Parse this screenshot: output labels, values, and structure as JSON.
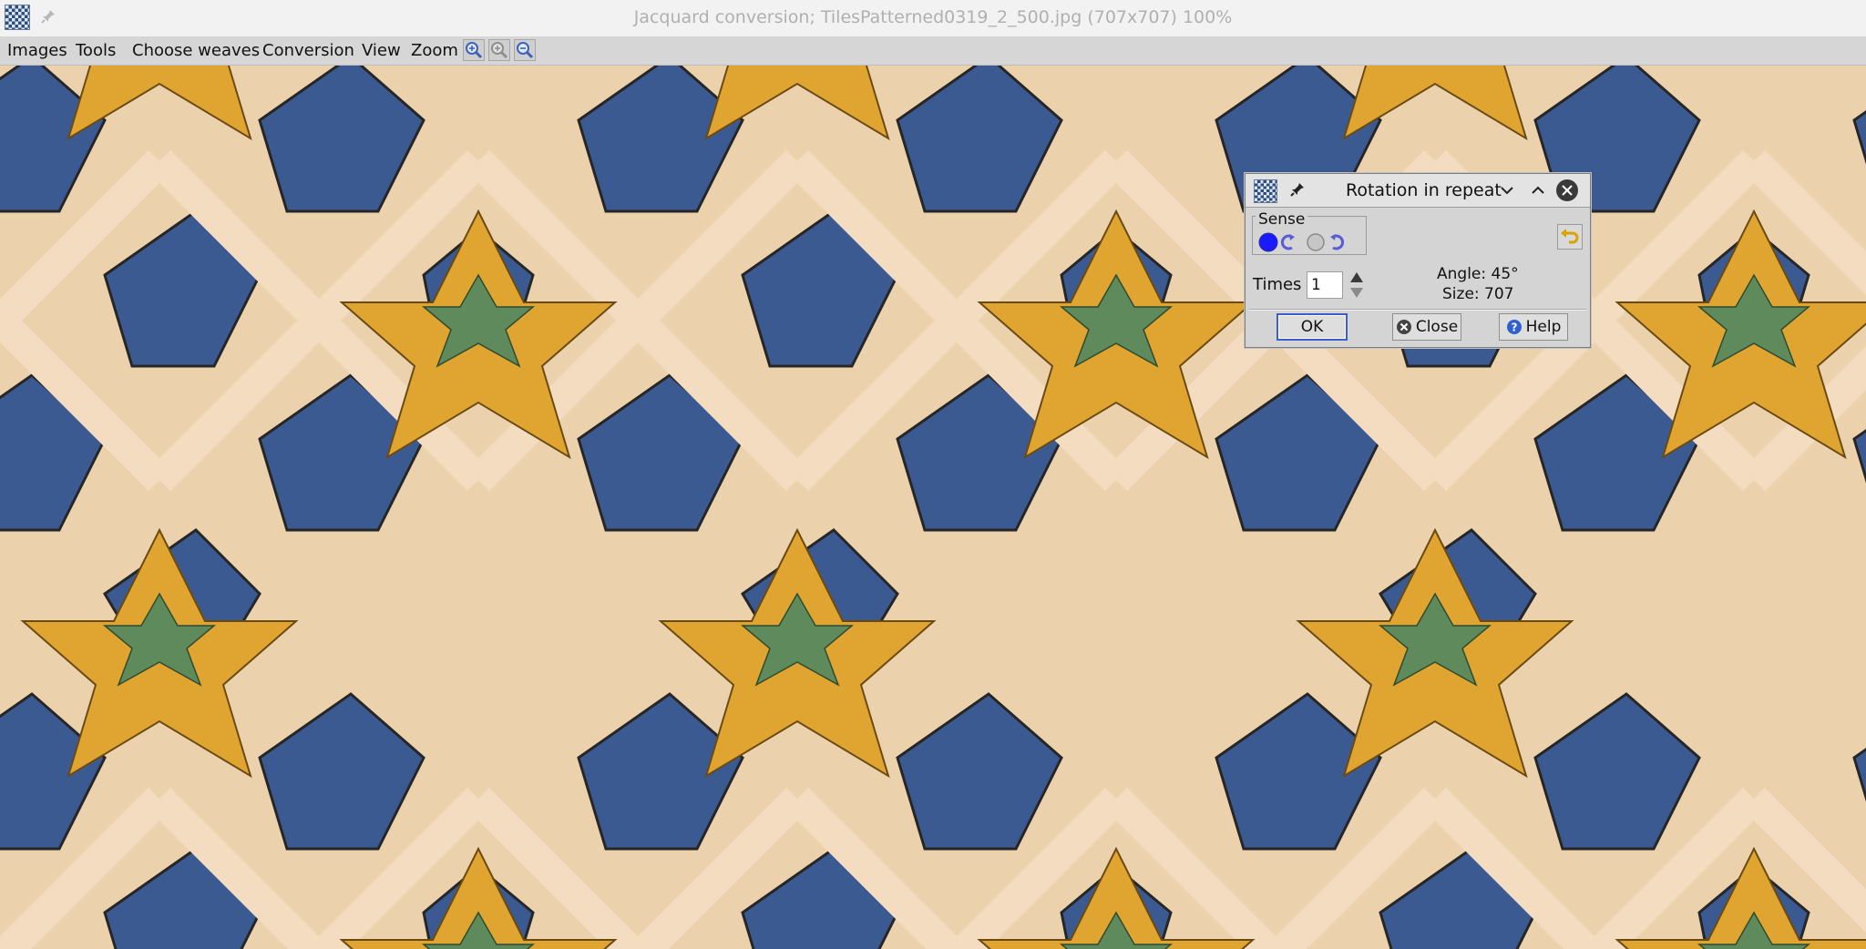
{
  "window": {
    "title": "Jacquard conversion; TilesPatterned0319_2_500.jpg (707x707) 100%"
  },
  "menubar": {
    "items": [
      {
        "label": "Images"
      },
      {
        "label": "Tools"
      },
      {
        "label": "Choose weaves"
      },
      {
        "label": "Conversion"
      },
      {
        "label": "View"
      },
      {
        "label": "Zoom"
      }
    ],
    "zoom_icons": [
      "zoom-reset-icon",
      "zoom-in-icon",
      "zoom-out-icon"
    ]
  },
  "image": {
    "name": "TilesPatterned0319_2_500.jpg",
    "colors": {
      "background": "#ecd1ad",
      "blue": "#3c5a92",
      "yellow": "#e0a530",
      "green": "#5f8a5c",
      "outline": "#2a2a2a"
    }
  },
  "dialog": {
    "title": "Rotation in repeat",
    "sense": {
      "label": "Sense",
      "options": [
        "counterclockwise",
        "clockwise"
      ],
      "selected": "counterclockwise"
    },
    "times": {
      "label": "Times",
      "value": "1"
    },
    "angle": "Angle: 45°",
    "size": "Size: 707",
    "buttons": {
      "ok": "OK",
      "close": "Close",
      "help": "Help"
    }
  }
}
